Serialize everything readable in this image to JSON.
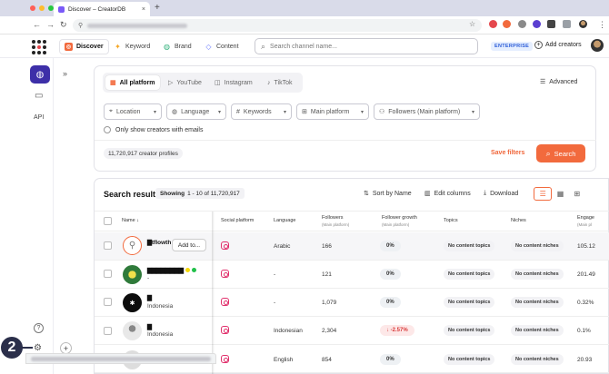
{
  "browser": {
    "tab_title": "Discover – CreatorDB",
    "new_tab": "+",
    "tab_close": "×"
  },
  "app": {
    "nav": [
      {
        "label": "Discover",
        "icon": "discover-icon"
      },
      {
        "label": "Keyword",
        "icon": "keyword-icon"
      },
      {
        "label": "Brand",
        "icon": "brand-icon"
      },
      {
        "label": "Content",
        "icon": "content-icon"
      }
    ],
    "search_placeholder": "Search channel name...",
    "plan_badge": "ENTERPRISE",
    "add_creators": "Add creators"
  },
  "sidebar": {
    "api": "API",
    "help": "?",
    "expand": "»",
    "step_badge": "2",
    "plus": "+"
  },
  "filters": {
    "platform_tabs": [
      {
        "label": "All platform"
      },
      {
        "label": "YouTube"
      },
      {
        "label": "Instagram"
      },
      {
        "label": "TikTok"
      }
    ],
    "advanced": "Advanced",
    "selects": [
      {
        "label": "Location"
      },
      {
        "label": "Language"
      },
      {
        "label": "Keywords"
      },
      {
        "label": "Main platform"
      },
      {
        "label": "Followers (Main platform)"
      }
    ],
    "emails_only": "Only show creators with emails",
    "profiles_count": "11,720,917 creator profiles",
    "save_filters": "Save filters",
    "search_button": "Search"
  },
  "results": {
    "title": "Search results",
    "showing_label": "Showing",
    "showing_range": "1 - 10 of 11,720,917",
    "sort_by": "Sort by Name",
    "edit_columns": "Edit columns",
    "download": "Download",
    "columns": {
      "name": "Name",
      "social_platform": "Social platform",
      "language": "Language",
      "followers": "Followers",
      "followers_sub": "(Main platform)",
      "follower_growth": "Follower growth",
      "follower_growth_sub": "(Main platform)",
      "topics": "Topics",
      "niches": "Niches",
      "engagement": "Engage",
      "engagement_sub": "(Main pl"
    },
    "add_to": "Add to...",
    "rows": [
      {
        "name": "▇tflowth",
        "sub": "",
        "language": "Arabic",
        "followers": "166",
        "growth": "0%",
        "growth_negative": false,
        "topics": "No content topics",
        "niches": "No content niches",
        "engagement": "105.12"
      },
      {
        "name": "▇▇▇▇▇▇▇▇",
        "sub": "-",
        "language": "-",
        "followers": "121",
        "growth": "0%",
        "growth_negative": false,
        "topics": "No content topics",
        "niches": "No content niches",
        "engagement": "201.49"
      },
      {
        "name": "▇",
        "sub": "Indonesia",
        "language": "-",
        "followers": "1,079",
        "growth": "0%",
        "growth_negative": false,
        "topics": "No content topics",
        "niches": "No content niches",
        "engagement": "0.32%"
      },
      {
        "name": "▇",
        "sub": "Indonesia",
        "language": "Indonesian",
        "followers": "2,304",
        "growth": "-2.57%",
        "growth_negative": true,
        "topics": "No content topics",
        "niches": "No content niches",
        "engagement": "0.1%"
      },
      {
        "name": "",
        "sub": "",
        "language": "English",
        "followers": "854",
        "growth": "0%",
        "growth_negative": false,
        "topics": "No content topics",
        "niches": "No content niches",
        "engagement": "20.93"
      }
    ]
  },
  "colors": {
    "accent": "#f26a3d",
    "brand": "#3d2fa8",
    "negative": "#d93a3a"
  }
}
